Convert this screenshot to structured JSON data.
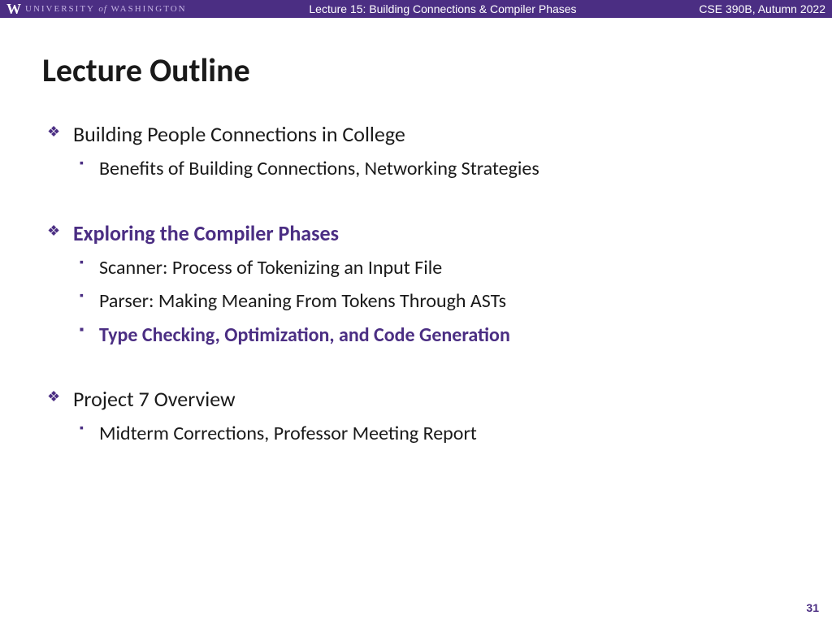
{
  "header": {
    "logo_w": "W",
    "logo_text_1": "UNIVERSITY",
    "logo_text_of": "of",
    "logo_text_2": "WASHINGTON",
    "title": "Lecture 15: Building Connections & Compiler Phases",
    "course": "CSE 390B, Autumn 2022"
  },
  "slide": {
    "title": "Lecture Outline",
    "items": [
      {
        "text": "Building People Connections in College",
        "highlighted": false,
        "subs": [
          {
            "text": "Benefits of Building Connections, Networking Strategies",
            "highlighted": false
          }
        ]
      },
      {
        "text": "Exploring the Compiler Phases",
        "highlighted": true,
        "subs": [
          {
            "text": "Scanner: Process of Tokenizing an Input File",
            "highlighted": false
          },
          {
            "text": "Parser: Making Meaning From Tokens Through ASTs",
            "highlighted": false
          },
          {
            "text": "Type Checking, Optimization, and Code Generation",
            "highlighted": true
          }
        ]
      },
      {
        "text": "Project 7 Overview",
        "highlighted": false,
        "subs": [
          {
            "text": "Midterm Corrections, Professor Meeting Report",
            "highlighted": false
          }
        ]
      }
    ]
  },
  "page_number": "31"
}
